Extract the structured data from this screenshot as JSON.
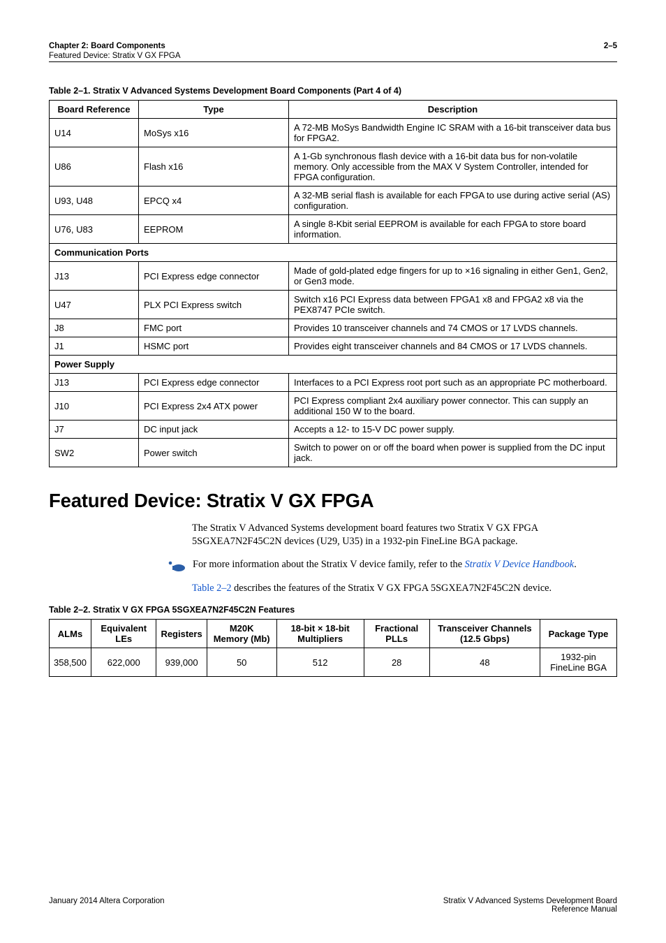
{
  "header": {
    "chapter": "Chapter 2: Board Components",
    "subtitle": "Featured Device: Stratix V GX FPGA",
    "page": "2–5"
  },
  "table1": {
    "caption": "Table 2–1. Stratix V Advanced Systems Development Board Components (Part 4 of 4)",
    "headers": {
      "ref": "Board Reference",
      "type": "Type",
      "desc": "Description"
    },
    "rows": [
      {
        "ref": "U14",
        "type": "MoSys x16",
        "desc": "A 72-MB MoSys Bandwidth Engine IC SRAM with a 16-bit transceiver data bus for FPGA2."
      },
      {
        "ref": "U86",
        "type": "Flash x16",
        "desc": "A 1-Gb synchronous flash device with a 16-bit data bus for non-volatile memory. Only accessible from the MAX V System Controller, intended for FPGA configuration."
      },
      {
        "ref": "U93, U48",
        "type": "EPCQ x4",
        "desc": "A 32-MB serial flash is available for each FPGA to use during active serial (AS) configuration."
      },
      {
        "ref": "U76, U83",
        "type": "EEPROM",
        "desc": "A single 8-Kbit serial EEPROM is available for each FPGA to store board information."
      }
    ],
    "section_comm": "Communication Ports",
    "rows_comm": [
      {
        "ref": "J13",
        "type": "PCI Express edge connector",
        "desc": "Made of gold-plated edge fingers for up to ×16 signaling in either Gen1, Gen2, or Gen3 mode."
      },
      {
        "ref": "U47",
        "type": "PLX PCI Express switch",
        "desc": "Switch x16 PCI Express data between FPGA1 x8 and FPGA2 x8 via the PEX8747 PCIe switch."
      },
      {
        "ref": "J8",
        "type": "FMC port",
        "desc": "Provides 10 transceiver channels and 74 CMOS or 17 LVDS channels."
      },
      {
        "ref": "J1",
        "type": "HSMC port",
        "desc": "Provides eight transceiver channels and 84 CMOS or 17 LVDS channels."
      }
    ],
    "section_power": "Power Supply",
    "rows_power": [
      {
        "ref": "J13",
        "type": "PCI Express edge connector",
        "desc": "Interfaces to a PCI Express root port such as an appropriate PC motherboard."
      },
      {
        "ref": "J10",
        "type": "PCI Express 2x4 ATX power",
        "desc": "PCI Express compliant 2x4 auxiliary power connector. This can supply an additional 150 W to the board."
      },
      {
        "ref": "J7",
        "type": "DC input jack",
        "desc": "Accepts a 12- to 15-V DC power supply."
      },
      {
        "ref": "SW2",
        "type": "Power switch",
        "desc": "Switch to power on or off the board when power is supplied from the DC input jack."
      }
    ]
  },
  "section_title": "Featured Device: Stratix V GX FPGA",
  "para1": "The Stratix V Advanced Systems development board features two Stratix V GX FPGA 5SGXEA7N2F45C2N devices (U29, U35) in a 1932-pin FineLine BGA package.",
  "note": {
    "pre": "For more information about the Stratix V device family, refer to the ",
    "link": "Stratix V Device Handbook",
    "post": "."
  },
  "para2_pre": "",
  "para2_link": "Table 2–2",
  "para2_post": " describes the features of the Stratix V GX FPGA 5SGXEA7N2F45C2N device.",
  "table2": {
    "caption": "Table 2–2. Stratix V GX FPGA 5SGXEA7N2F45C2N Features",
    "headers": {
      "alms": "ALMs",
      "les": "Equivalent LEs",
      "regs": "Registers",
      "m20k": "M20K Memory (Mb)",
      "mult": "18-bit × 18-bit Multipliers",
      "plls": "Fractional PLLs",
      "xcvr": "Transceiver Channels (12.5 Gbps)",
      "pkg": "Package Type"
    },
    "row": {
      "alms": "358,500",
      "les": "622,000",
      "regs": "939,000",
      "m20k": "50",
      "mult": "512",
      "plls": "28",
      "xcvr": "48",
      "pkg": "1932-pin FineLine BGA"
    }
  },
  "footer": {
    "left": "January 2014   Altera Corporation",
    "right1": "Stratix V Advanced Systems Development Board",
    "right2": "Reference Manual"
  }
}
